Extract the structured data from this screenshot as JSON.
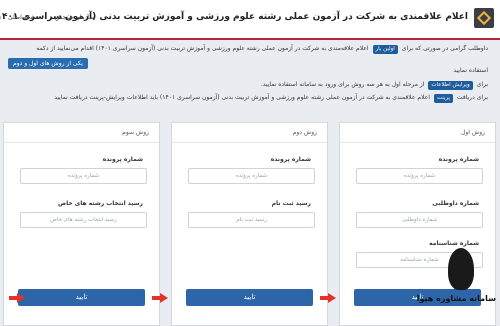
{
  "header": {
    "title": "اعلام علاقمندی به شرکت در آزمون عملی رشته علوم ورزشی و آموزش تربیت بدنی (آزمون سراسری ۱۴۰۱)",
    "nav": [
      "صفحه اصلی",
      "سازمان سنجش"
    ]
  },
  "notices": {
    "line1_text": "داوطلب گرامی در صورتی که برای",
    "line1_tag": "اولین بار",
    "line1_rest": "اعلام علاقه‌مندی به شرکت در آزمون عملی رشته علوم ورزشی و آموزش تربیت بدنی (آزمون سراسری ۱۴۰۱) اقدام می‌نمایید از دکمه",
    "line1b": "استفاده نمایید",
    "line2_text": "برای",
    "line2_tag": "ویرایش اطلاعات",
    "line2_rest": "از مرحله اول به هر سه روش برای ورود به سامانه استفاده نمایید.",
    "line3_text": "برای دریافت",
    "line3_tag": "پرینت",
    "line3_rest": "اعلام علاقمندی به شرکت در آزمون عملی رشته علوم ورزشی و آموزش تربیت بدنی (آزمون سراسری ۱۴۰۱) باید اطلاعات ویرایش-پرینت دریافت نمایید",
    "blue_button": "یکی از روش های اول و دوم"
  },
  "cards": [
    {
      "title": "روش اول",
      "fields": [
        {
          "label": "شماره پرونده",
          "placeholder": "شماره پرونده"
        },
        {
          "label": "شماره داوطلبی",
          "placeholder": "شماره داوطلبی"
        },
        {
          "label": "شماره شناسنامه",
          "placeholder": "شماره شناسنامه"
        }
      ],
      "submit": "تایید"
    },
    {
      "title": "روش دوم",
      "fields": [
        {
          "label": "شماره پرونده",
          "placeholder": "شماره پرونده"
        },
        {
          "label": "رسید ثبت نام",
          "placeholder": "رسید ثبت نام"
        }
      ],
      "submit": "تایید"
    },
    {
      "title": "روش سوم",
      "fields": [
        {
          "label": "شماره پرونده",
          "placeholder": "شماره پرونده"
        },
        {
          "label": "رسید انتخاب رشته های خاص",
          "placeholder": "رسید انتخاب رشته های خاص"
        }
      ],
      "submit": "تایید"
    }
  ],
  "watermark": "سامانه مشاوره هپوا",
  "colors": {
    "accent": "#b3263a",
    "button": "#2d66a8",
    "arrow": "#e2322e"
  }
}
